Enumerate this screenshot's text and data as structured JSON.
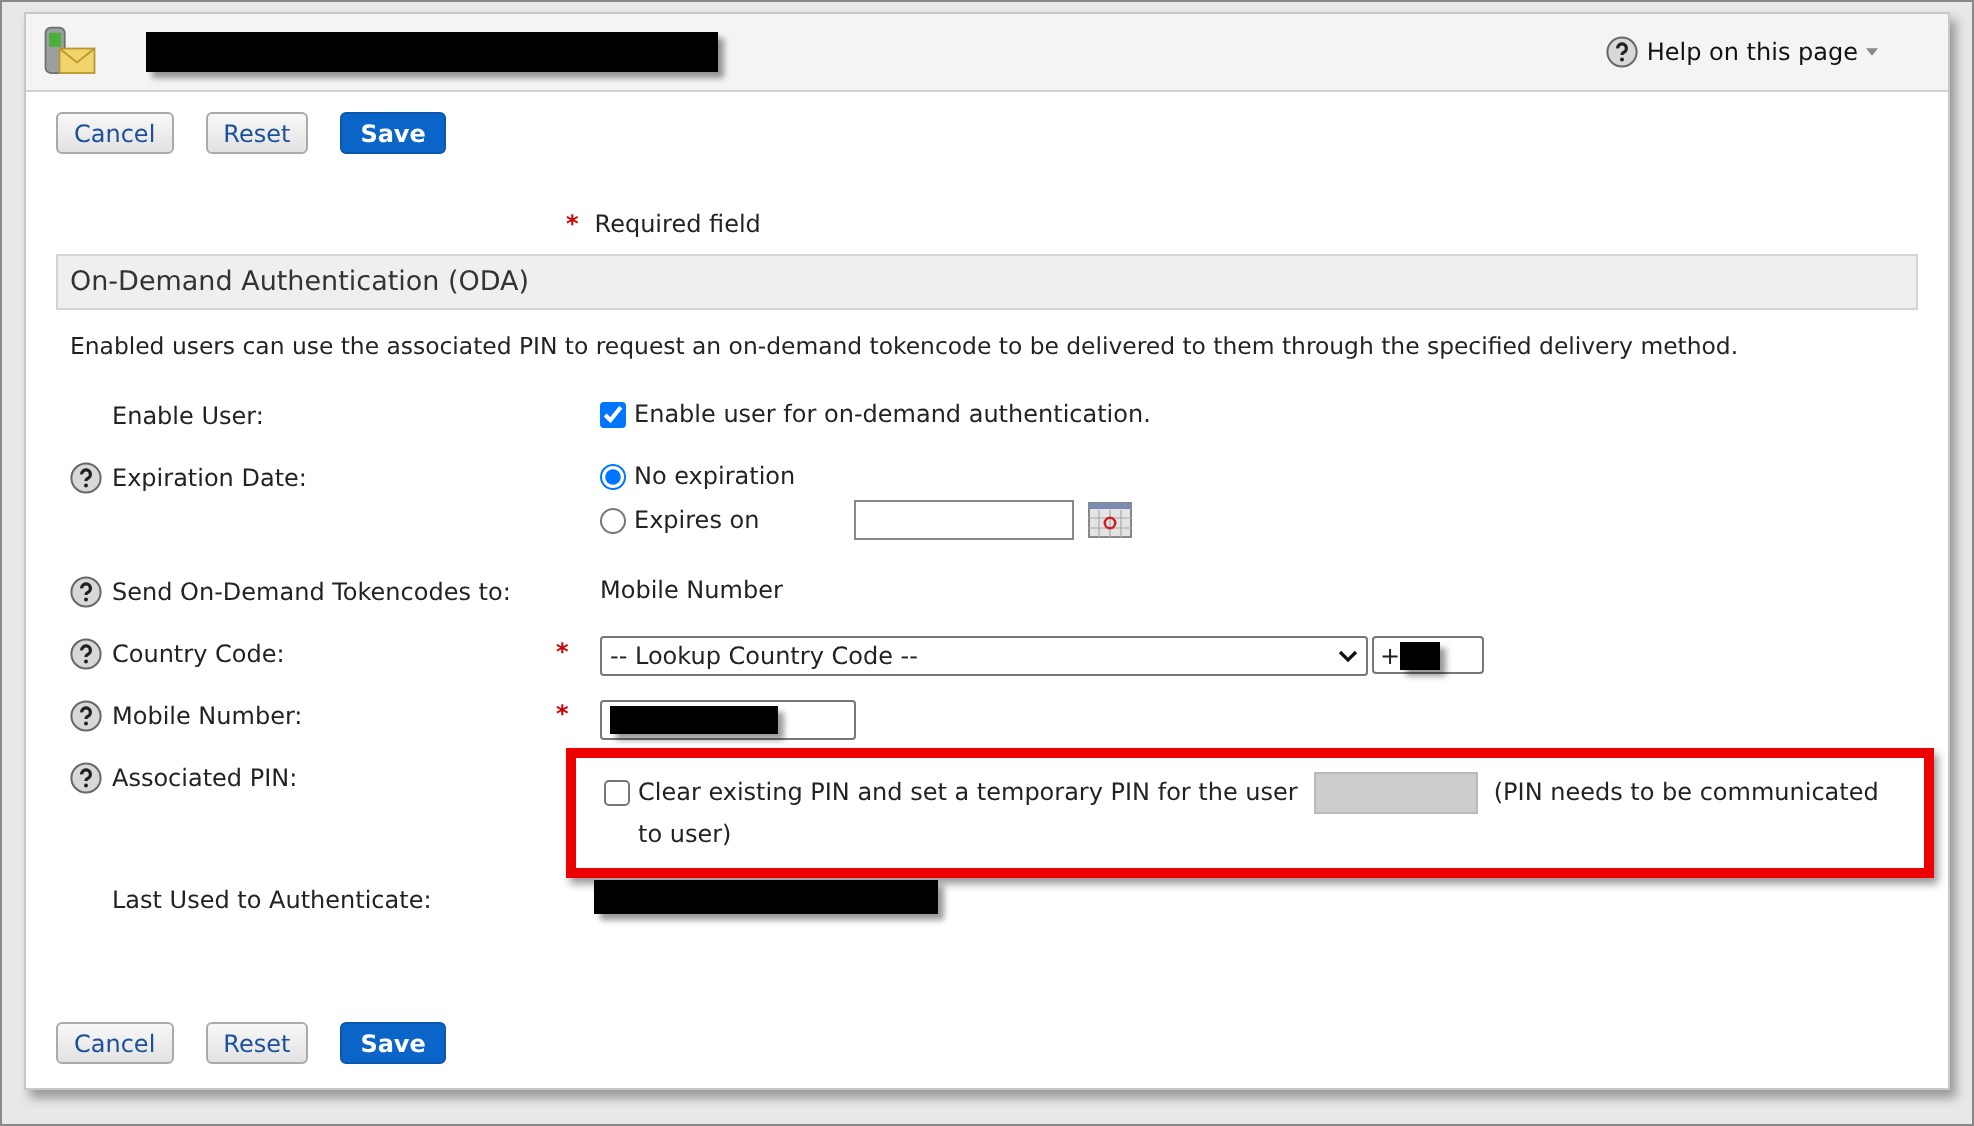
{
  "header": {
    "help_link": "Help on this page"
  },
  "top_buttons": [
    {
      "label": "Cancel",
      "kind": "secondary"
    },
    {
      "label": "Reset",
      "kind": "secondary"
    },
    {
      "label": "Save",
      "kind": "primary"
    }
  ],
  "required_note": {
    "mark": "*",
    "text": "Required field"
  },
  "section": {
    "title": "On-Demand Authentication (ODA)",
    "description": "Enabled users can use the associated PIN to request an on-demand tokencode to be delivered to them through the specified delivery method."
  },
  "fields": [
    {
      "kind": "checkbox",
      "label": "Enable User:",
      "help": false,
      "required": false,
      "checked": true,
      "option": "Enable user for on-demand authentication."
    },
    {
      "kind": "radio",
      "label": "Expiration Date:",
      "help": true,
      "required": false,
      "options": [
        {
          "label": "No expiration",
          "selected": true,
          "date_field": false
        },
        {
          "label": "Expires on",
          "selected": false,
          "date_field": true
        }
      ]
    },
    {
      "kind": "text",
      "label": "Send On-Demand Tokencodes to:",
      "help": true,
      "required": false,
      "value": "Mobile Number"
    },
    {
      "kind": "select",
      "label": "Country Code:",
      "help": true,
      "required": true,
      "value": "-- Lookup Country Code --",
      "prefix": "+"
    },
    {
      "kind": "input",
      "label": "Mobile Number:",
      "help": true,
      "required": true
    },
    {
      "kind": "pin",
      "label": "Associated PIN:",
      "help": true,
      "required": false,
      "checked": false,
      "highlighted": true,
      "option": "Clear existing PIN and set a temporary PIN for the user",
      "note": "(PIN needs to be communicated to user)"
    },
    {
      "kind": "redacted",
      "label": "Last Used to Authenticate:",
      "help": false,
      "required": false
    }
  ],
  "bottom_buttons": [
    {
      "label": "Cancel",
      "kind": "secondary"
    },
    {
      "label": "Reset",
      "kind": "secondary"
    },
    {
      "label": "Save",
      "kind": "primary"
    }
  ]
}
